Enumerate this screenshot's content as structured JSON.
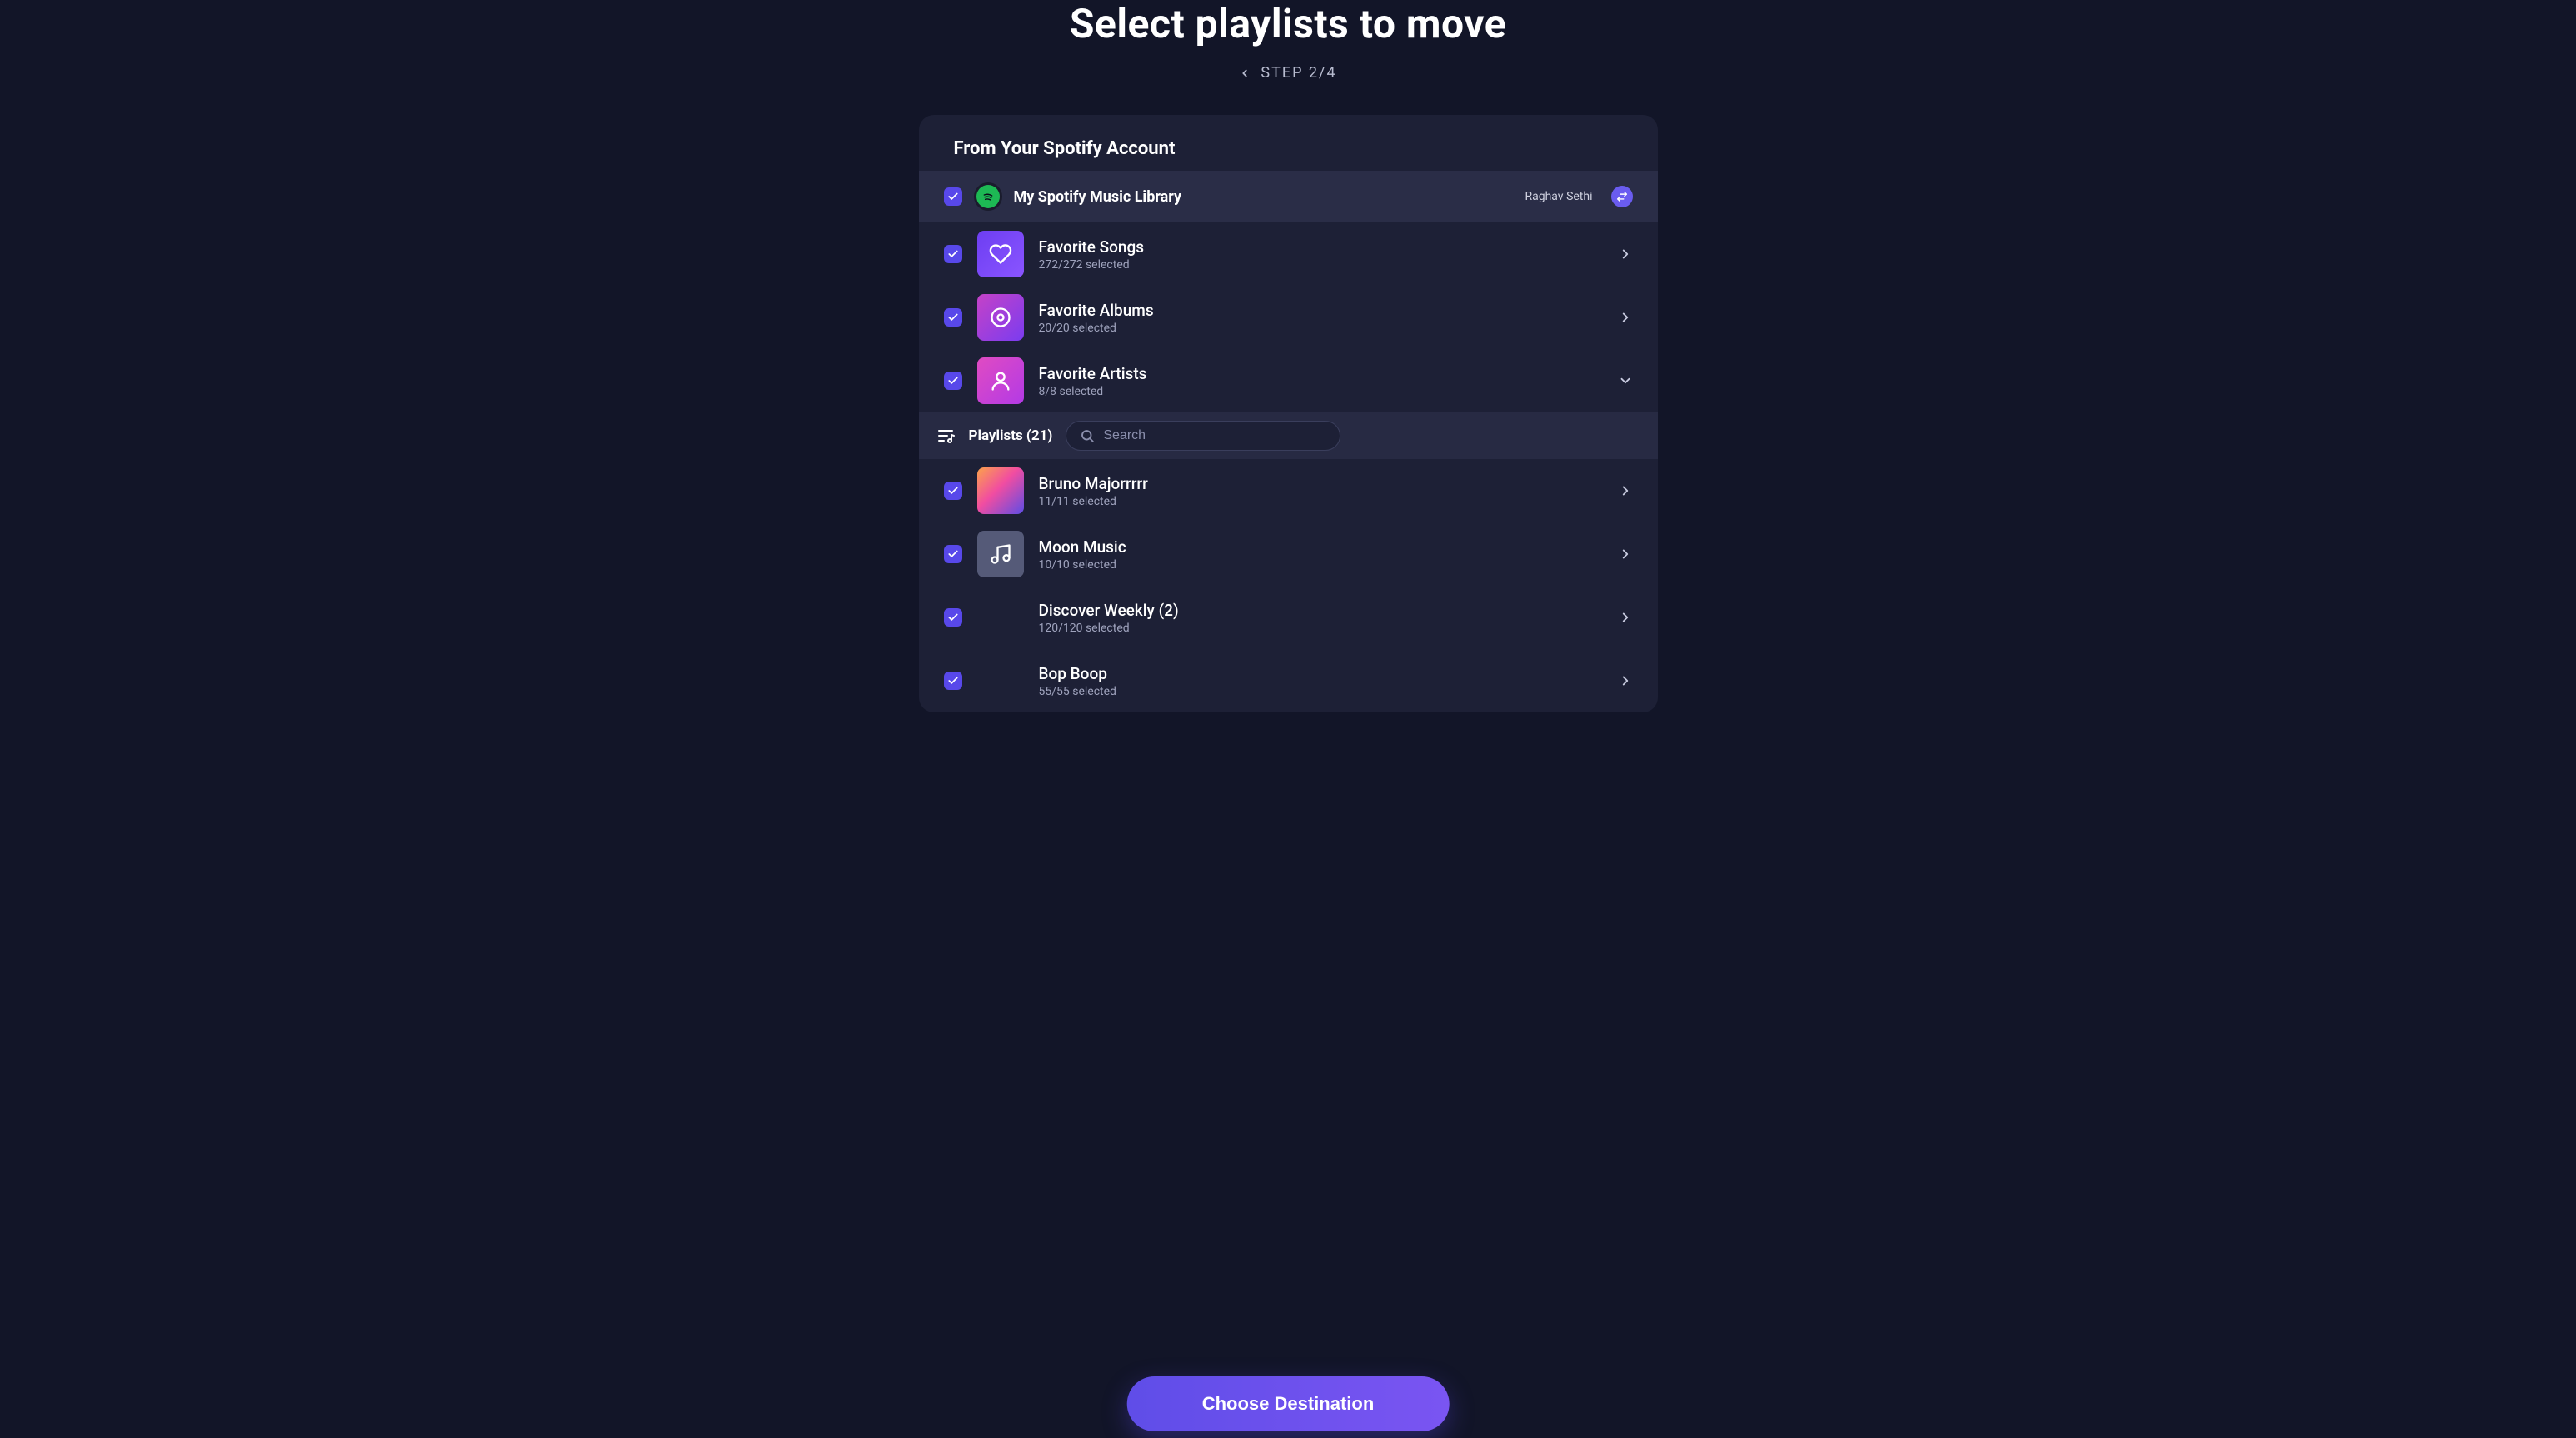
{
  "header": {
    "title": "Select playlists to move",
    "step": "STEP 2/4"
  },
  "card": {
    "subtitle": "From Your Spotify Account",
    "library": {
      "name": "My Spotify Music Library",
      "user": "Raghav Sethi"
    },
    "favorites": [
      {
        "title": "Favorite Songs",
        "sub": "272/272 selected",
        "icon": "heart",
        "grad": "grad-purple",
        "arrow": "right"
      },
      {
        "title": "Favorite Albums",
        "sub": "20/20 selected",
        "icon": "disc",
        "grad": "grad-pink",
        "arrow": "right"
      },
      {
        "title": "Favorite Artists",
        "sub": "8/8 selected",
        "icon": "person",
        "grad": "grad-pink2",
        "arrow": "down"
      }
    ],
    "playlists_label": "Playlists (21)",
    "search_placeholder": "Search",
    "playlists": [
      {
        "title": "Bruno Majorrrrr",
        "sub": "11/11 selected",
        "thumb": "grad-sunset"
      },
      {
        "title": "Moon Music",
        "sub": "10/10 selected",
        "thumb": "grad-gray",
        "icon": "music"
      },
      {
        "title": "Discover Weekly (2)",
        "sub": "120/120 selected",
        "thumb": "grad-collage"
      },
      {
        "title": "Bop Boop",
        "sub": "55/55 selected",
        "thumb": "grad-collage2"
      }
    ]
  },
  "cta": "Choose Destination"
}
